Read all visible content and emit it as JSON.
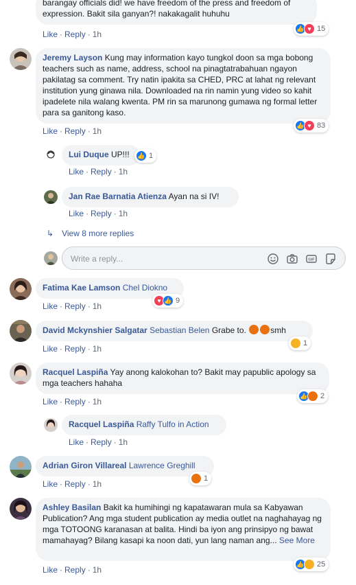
{
  "placeholder_reply": "Write a reply...",
  "comments": [
    {
      "id": "c0",
      "author": "",
      "text": "barangay officials did! we have freedom of the press and freedom of expression. Bakit sila ganyan?! nakakagalit huhuhu",
      "actions": {
        "like": "Like",
        "reply": "Reply",
        "time": "1h"
      },
      "reactions": {
        "icons": [
          "like",
          "love"
        ],
        "count": "15"
      }
    },
    {
      "id": "c1",
      "author": "Jeremy Layson",
      "text": "Kung may information kayo tungkol doon sa mga bobong teachers such as name, address, school na pinagtatrabahuan ngayon pakilatag sa comment. Try natin ipakita sa CHED, PRC at lahat ng relevant institution yung ginawa nila. Downloaded na rin namin yung video so kahit ipadelete nila walang kwenta. PM rin sa marunong gumawa ng formal letter para sa ganitong kaso.",
      "actions": {
        "like": "Like",
        "reply": "Reply",
        "time": "1h"
      },
      "reactions": {
        "icons": [
          "like",
          "love"
        ],
        "count": "83"
      }
    },
    {
      "id": "r1",
      "author": "Lui Duque",
      "text": "UP!!!",
      "actions": {
        "like": "Like",
        "reply": "Reply",
        "time": "1h"
      },
      "reactions": {
        "icons": [
          "like"
        ],
        "count": "1"
      }
    },
    {
      "id": "r2",
      "author": "Jan Rae Barnatia Atienza",
      "text": "Ayan na si IV!",
      "actions": {
        "like": "Like",
        "reply": "Reply",
        "time": "1h"
      }
    },
    {
      "id": "c2",
      "author": "Fatima Kae Lamson",
      "mention": "Chel Diokno",
      "text": "",
      "actions": {
        "like": "Like",
        "reply": "Reply",
        "time": "1h"
      },
      "reactions": {
        "icons": [
          "love",
          "like"
        ],
        "count": "9"
      }
    },
    {
      "id": "c3",
      "author": "David Mckynshier Salgatar",
      "mention": "Sebastian Belen",
      "text": "Grabe to.",
      "text_after": "smh",
      "actions": {
        "like": "Like",
        "reply": "Reply",
        "time": "1h"
      },
      "reactions": {
        "icons": [
          "sad"
        ],
        "count": "1"
      }
    },
    {
      "id": "c4",
      "author": "Racquel Laspiña",
      "text": "Yay anong kalokohan to? Bakit may papublic apology sa mga teachers hahaha",
      "actions": {
        "like": "Like",
        "reply": "Reply",
        "time": "1h"
      },
      "reactions": {
        "icons": [
          "like",
          "angry"
        ],
        "count": "2"
      }
    },
    {
      "id": "r3",
      "author": "Racquel Laspiña",
      "mention": "Raffy Tulfo in Action",
      "text": "",
      "actions": {
        "like": "Like",
        "reply": "Reply",
        "time": "1h"
      }
    },
    {
      "id": "c5",
      "author": "Adrian Giron Villareal",
      "mention": "Lawrence Greghill",
      "text": "",
      "actions": {
        "like": "Like",
        "reply": "Reply",
        "time": "1h"
      },
      "reactions": {
        "icons": [
          "angry"
        ],
        "count": "1"
      }
    },
    {
      "id": "c6",
      "author": "Ashley Basilan",
      "text": "Bakit ka humihingi ng kapatawaran mula sa Kabyawan Publication? Ang mga student publication ay media outlet na naghahayag ng mga TOTOONG karanasan at balita. Hindi ba iyon ang prinsipyo ng bawat mamahayag? Bilang kasapi ka noon dati, yun lang naman ang...",
      "see_more": "See More",
      "actions": {
        "like": "Like",
        "reply": "Reply",
        "time": "1h"
      },
      "reactions": {
        "icons": [
          "like",
          "sad"
        ],
        "count": "25"
      }
    }
  ],
  "view_more_replies": "View 8 more replies"
}
